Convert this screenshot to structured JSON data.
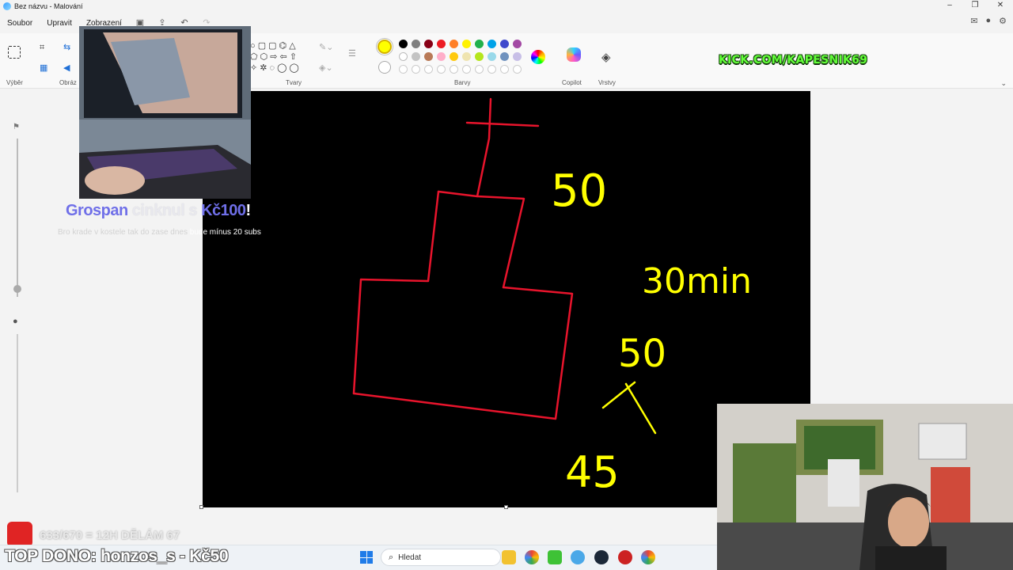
{
  "window": {
    "title": "Bez názvu - Malování",
    "controls": [
      "–",
      "❐",
      "✕"
    ]
  },
  "menu": {
    "items": [
      "Soubor",
      "Upravit",
      "Zobrazení"
    ]
  },
  "ribbon": {
    "groups": {
      "select": "Výběr",
      "image": "Obráz",
      "shapes": "Tvary",
      "colors": "Barvy",
      "copilot": "Copilot",
      "layers": "Vrstvy"
    },
    "palette_row1": [
      "#000000",
      "#7f7f7f",
      "#880015",
      "#ed1c24",
      "#ff7f27",
      "#fff200",
      "#22b14c",
      "#00a2e8",
      "#3f48cc",
      "#a349a4"
    ],
    "palette_row2": [
      "#ffffff",
      "#c3c3c3",
      "#b97a57",
      "#ffaec9",
      "#ffc90e",
      "#efe4b0",
      "#b5e61d",
      "#99d9ea",
      "#7092be",
      "#c8bfe7"
    ],
    "primary_color": "#ffff00",
    "secondary_color": "#ffffff"
  },
  "overlay": {
    "kick": "KICK.COM/KAPESNIK69",
    "alert": {
      "name": "Grospan",
      "mid": " cinknul s ",
      "amount": "Kč100",
      "excl": "!",
      "message_a": "Bro krade v kostele tak do zase dnes ",
      "message_b": "bude mínus 20 subs"
    },
    "goal": "633/670 = 12H DĚLÁM 67",
    "top_dono": "TOP DONO: honzos_s - Kč50"
  },
  "canvas_text": {
    "t1": "50",
    "t2": "30min",
    "t3": "50",
    "t4": "45"
  },
  "taskbar": {
    "search_placeholder": "Hledat"
  }
}
